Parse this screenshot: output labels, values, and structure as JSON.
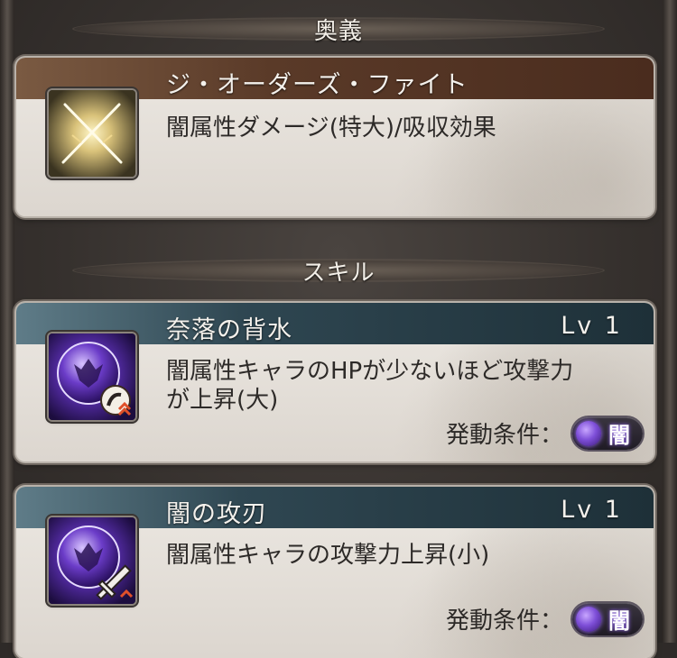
{
  "sections": {
    "ougi": {
      "header": "奥義"
    },
    "skills": {
      "header": "スキル"
    }
  },
  "ougi": {
    "name": "ジ・オーダーズ・ファイト",
    "description": "闇属性ダメージ(特大)/吸収効果",
    "icon": "crossed-swords-icon"
  },
  "skills": [
    {
      "name": "奈落の背水",
      "level": "Lv 1",
      "description_lines": [
        "闇属性キャラのHPが少ないほど攻撃力",
        "が上昇(大)"
      ],
      "condition_label": "発動条件：",
      "element": "闇",
      "icon": "dark-backwater-skill-icon"
    },
    {
      "name": "闇の攻刃",
      "level": "Lv 1",
      "description_lines": [
        "闇属性キャラの攻撃力上昇(小)"
      ],
      "condition_label": "発動条件：",
      "element": "闇",
      "icon": "dark-might-skill-icon"
    }
  ],
  "colors": {
    "ougi_title_bar": "#5a3a28",
    "skill_title_bar": "#2f4752",
    "dark_element": "#7e4fd8"
  }
}
